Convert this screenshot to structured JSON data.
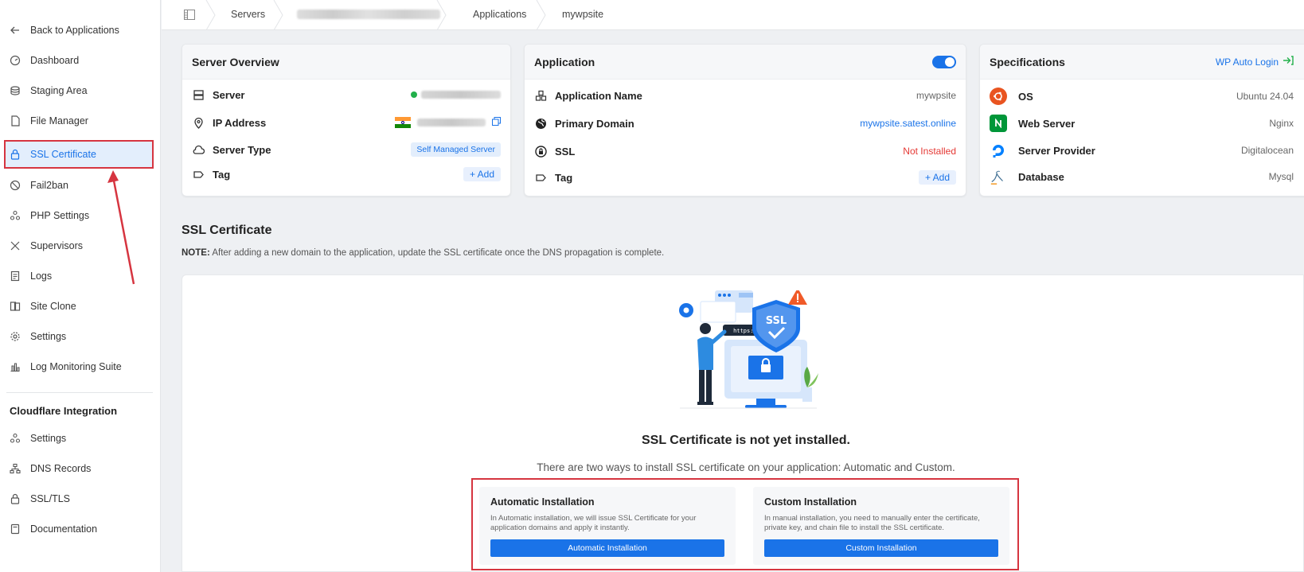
{
  "sidebar": {
    "back": "Back to Applications",
    "items": [
      {
        "label": "Dashboard",
        "icon": "dashboard-icon"
      },
      {
        "label": "Staging Area",
        "icon": "staging-icon"
      },
      {
        "label": "File Manager",
        "icon": "file-icon"
      },
      {
        "label": "SSL Certificate",
        "icon": "lock-icon"
      },
      {
        "label": "Fail2ban",
        "icon": "ban-icon"
      },
      {
        "label": "PHP Settings",
        "icon": "php-icon"
      },
      {
        "label": "Supervisors",
        "icon": "tools-icon"
      },
      {
        "label": "Logs",
        "icon": "log-icon"
      },
      {
        "label": "Site Clone",
        "icon": "clone-icon"
      },
      {
        "label": "Settings",
        "icon": "gear-icon"
      },
      {
        "label": "Log Monitoring Suite",
        "icon": "chart-icon"
      }
    ],
    "cloudflare_heading": "Cloudflare Integration",
    "cloudflare_items": [
      {
        "label": "Settings",
        "icon": "settings-icon"
      },
      {
        "label": "DNS Records",
        "icon": "dns-icon"
      },
      {
        "label": "SSL/TLS",
        "icon": "lock-icon"
      },
      {
        "label": "Documentation",
        "icon": "doc-icon"
      }
    ]
  },
  "breadcrumb": {
    "servers": "Servers",
    "applications": "Applications",
    "current": "mywpsite"
  },
  "server_overview": {
    "title": "Server Overview",
    "server_label": "Server",
    "ip_label": "IP Address",
    "type_label": "Server Type",
    "type_value": "Self Managed Server",
    "tag_label": "Tag",
    "add_label": "+ Add"
  },
  "application": {
    "title": "Application",
    "name_label": "Application Name",
    "name_value": "mywpsite",
    "domain_label": "Primary Domain",
    "domain_value": "mywpsite.satest.online",
    "ssl_label": "SSL",
    "ssl_value": "Not Installed",
    "tag_label": "Tag",
    "add_label": "+ Add"
  },
  "specifications": {
    "title": "Specifications",
    "wp_login": "WP Auto Login",
    "os_label": "OS",
    "os_value": "Ubuntu 24.04",
    "web_label": "Web Server",
    "web_value": "Nginx",
    "provider_label": "Server Provider",
    "provider_value": "Digitalocean",
    "db_label": "Database",
    "db_value": "Mysql"
  },
  "ssl_section": {
    "title": "SSL Certificate",
    "note_prefix": "NOTE:",
    "note_text": " After adding a new domain to the application, update the SSL certificate once the DNS propagation is complete.",
    "not_installed": "SSL Certificate is not yet installed.",
    "ways": "There are two ways to install SSL certificate on your application: Automatic and Custom.",
    "https_label": "https://",
    "ssl_badge": "SSL",
    "auto": {
      "title": "Automatic Installation",
      "desc": "In Automatic installation, we will issue SSL Certificate for your application domains and apply it instantly.",
      "button": "Automatic Installation"
    },
    "custom": {
      "title": "Custom Installation",
      "desc": "In manual installation, you need to manually enter the certificate, private key, and chain file to install the SSL certificate.",
      "button": "Custom Installation"
    }
  },
  "colors": {
    "accent": "#1a73e8",
    "highlight": "#d63540",
    "danger": "#e53935",
    "success": "#22b04b"
  }
}
